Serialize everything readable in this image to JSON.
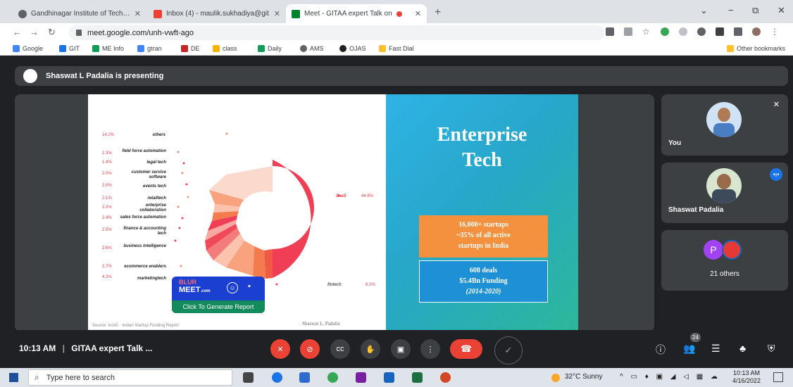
{
  "tabs": [
    {
      "label": "Gandhinagar Institute of Technol",
      "icon": "globe-icon"
    },
    {
      "label": "Inbox (4) - maulik.sukhadiya@git",
      "icon": "gmail-icon"
    },
    {
      "label": "Meet - GITAA expert Talk on",
      "icon": "meet-icon"
    }
  ],
  "window": {
    "minimize": "⌄",
    "min": "−",
    "restore": "⧉",
    "close": "✕"
  },
  "address": {
    "url": "meet.google.com/unh-vwft-ago"
  },
  "bookmarks": [
    "Google",
    "GIT",
    "ME Info",
    "gtran",
    "DE",
    "class",
    "Daily",
    "AMS",
    "OJAS",
    "Fast Dial"
  ],
  "other_bookmarks": "Other bookmarks",
  "presenting": "Shaswat L Padalia is presenting",
  "slide": {
    "title_line1": "Enterprise",
    "title_line2": "Tech",
    "box1_line1": "16,000+ startups",
    "box1_line2": "~35% of all active",
    "box1_line3": "startups in India",
    "box2_line1": "608 deals",
    "box2_line2": "$5.4Bn Funding",
    "box2_line3": "(2014-2020)",
    "source": "Source: Inc42 · Indian Startup Funding Report",
    "author": "Shaswat L. Padalia",
    "saas_label": "SaaS",
    "saas_pct": "44.8%",
    "fintech_label": "fintech",
    "fintech_pct": "6.1%",
    "labels": [
      {
        "pct": "14.2%",
        "text": "others"
      },
      {
        "pct": "1.3%",
        "text": "field force automation"
      },
      {
        "pct": "1.4%",
        "text": "legal tech"
      },
      {
        "pct": "2.0%",
        "text": "customer service software"
      },
      {
        "pct": "2.0%",
        "text": "events tech"
      },
      {
        "pct": "2.1%",
        "text": "retailtech"
      },
      {
        "pct": "2.2%",
        "text": "enterprise collaboration"
      },
      {
        "pct": "2.4%",
        "text": "sales force automation"
      },
      {
        "pct": "2.5%",
        "text": "finance & accounting tech"
      },
      {
        "pct": "2.6%",
        "text": "business intelligence"
      },
      {
        "pct": "2.7%",
        "text": "ecommerce enablers"
      },
      {
        "pct": "4.2%",
        "text": "marketingtech"
      }
    ]
  },
  "participants": {
    "you": "You",
    "presenter": "Shaswat Padalia",
    "others_initial": "P",
    "others": "21 others"
  },
  "controls": {
    "time": "10:13 AM",
    "separator": "|",
    "meeting_title": "GITAA expert Talk ...",
    "people_count": "24"
  },
  "blur_ext": {
    "brand1": "BLUR",
    "brand2": "MEET",
    "brand2_suffix": ".com",
    "action": "Click To Generate Report"
  },
  "taskbar": {
    "search_placeholder": "Type here to search",
    "weather": "32°C  Sunny",
    "time": "10:13 AM",
    "date": "4/16/2022"
  },
  "colors": {
    "meet_bg": "#202124",
    "tile_bg": "#3c4043",
    "red": "#ea4335",
    "blur_ext": "#1a3fd1"
  }
}
